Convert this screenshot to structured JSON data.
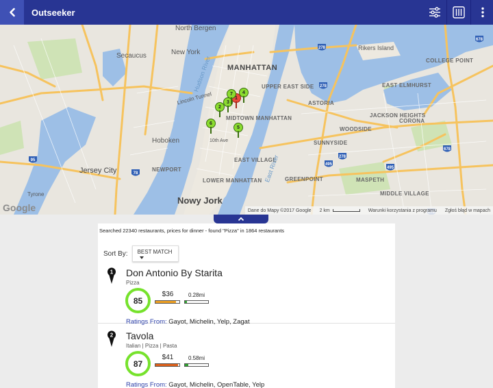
{
  "app": {
    "title": "Outseeker"
  },
  "colors": {
    "topbar": "#283593",
    "accent": "#3f51b5",
    "score_ring": "#76e22c",
    "price_fill": "#f0a020",
    "distance_fill": "#2ea12e"
  },
  "toolbar": {
    "icons": [
      "filter-sliders-icon",
      "restaurant-utensils-icon",
      "more-vert-icon"
    ]
  },
  "map": {
    "labels": {
      "north_bergen": "North Bergen",
      "new_york": "New York",
      "secaucus": "Secaucus",
      "manhattan": "MANHATTAN",
      "upper_east_side": "UPPER EAST SIDE",
      "midtown": "MIDTOWN MANHATTAN",
      "hoboken": "Hoboken",
      "jersey_city": "Jersey City",
      "newport": "NEWPORT",
      "lower_manhattan": "LOWER MANHATTAN",
      "nowy_jork": "Nowy Jork",
      "rikers": "Rikers Island",
      "college_point": "COLLEGE POINT",
      "east_elmhurst": "EAST ELMHURST",
      "jackson_heights": "JACKSON HEIGHTS",
      "woodside": "WOODSIDE",
      "corona": "CORONA",
      "sunnyside": "SUNNYSIDE",
      "greenpoint": "GREENPOINT",
      "maspeth": "MASPETH",
      "middle_village": "MIDDLE VILLAGE",
      "astoria": "ASTORIA",
      "east_village": "EAST VILLAGE",
      "lincoln_tunnel": "Lincoln Tunnel",
      "tenth_ave": "10th Ave",
      "tyrone": "Tyrone",
      "hudson_river": "Hudson River",
      "east_river": "East River"
    },
    "google": "Google",
    "attribution": {
      "data": "Dane do Mapy ©2017 Google",
      "scale": "2 km",
      "terms": "Warunki korzystania z programu",
      "report": "Zgłoś błąd w mapach"
    },
    "markers": [
      {
        "num": "1",
        "color": "#ea4b3c"
      },
      {
        "num": "2",
        "color": "#8bdc2f"
      },
      {
        "num": "3",
        "color": "#8bdc2f"
      },
      {
        "num": "4",
        "color": "#8bdc2f"
      },
      {
        "num": "5",
        "color": "#8bdc2f"
      },
      {
        "num": "6",
        "color": "#8bdc2f"
      },
      {
        "num": "7",
        "color": "#8bdc2f"
      }
    ]
  },
  "results": {
    "summary": "Searched 22340 restaurants, prices for dinner - found \"Pizza\" in 1864 restaurants",
    "sort_label": "Sort By:",
    "sort_value": "BEST MATCH",
    "items": [
      {
        "rank": "1",
        "name": "Don Antonio By Starita",
        "category": "Pizza",
        "score": "85",
        "price": "$36",
        "price_level": 0.85,
        "price_color": "#f0a020",
        "distance": "0.28mi",
        "distance_level": 0.08,
        "ratings_label": "Ratings From:",
        "ratings_sources": "Gayot, Michelin, Yelp, Zagat"
      },
      {
        "rank": "2",
        "name": "Tavola",
        "category": "Italian | Pizza | Pasta",
        "score": "87",
        "price": "$41",
        "price_level": 0.95,
        "price_color": "#e06018",
        "distance": "0.58mi",
        "distance_level": 0.15,
        "ratings_label": "Ratings From:",
        "ratings_sources": "Gayot, Michelin, OpenTable, Yelp"
      }
    ]
  }
}
